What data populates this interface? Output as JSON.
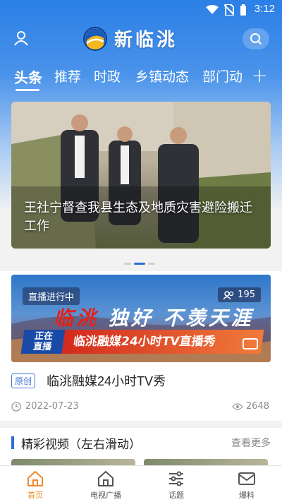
{
  "status_bar": {
    "time": "3:12"
  },
  "header": {
    "app_name": "新临洮"
  },
  "tabs": [
    {
      "label": "头条",
      "active": true
    },
    {
      "label": "推荐",
      "active": false
    },
    {
      "label": "时政",
      "active": false
    },
    {
      "label": "乡镇动态",
      "active": false
    },
    {
      "label": "部门动",
      "active": false
    }
  ],
  "tab_add_label": "+",
  "banner": {
    "caption": "王社宁督查我县生态及地质灾害避险搬迁工作",
    "total_slides": 3,
    "active_slide": 2
  },
  "live_card": {
    "tag": "直播进行中",
    "viewers": "195",
    "slogan_red": "临洮",
    "slogan_rest": "独好 不羡天涯",
    "badge_line1": "正在",
    "badge_line2": "直播",
    "strip_text": "临洮融媒24小时TV直播秀",
    "origin_label": "原创",
    "title": "临洮融媒24小时TV秀",
    "date": "2022-07-23",
    "views": "2648"
  },
  "section": {
    "title": "精彩视频（左右滑动）",
    "more": "查看更多"
  },
  "bottom_nav": [
    {
      "label": "首页",
      "icon": "home-icon",
      "active": true
    },
    {
      "label": "电视广播",
      "icon": "tv-home-icon",
      "active": false
    },
    {
      "label": "话题",
      "icon": "sliders-icon",
      "active": false
    },
    {
      "label": "爆料",
      "icon": "mail-icon",
      "active": false
    }
  ],
  "colors": {
    "header_blue": "#2b7fe6",
    "accent_blue": "#2b6fd6",
    "active_nav": "#f08a2b",
    "live_red": "#e0231a"
  }
}
